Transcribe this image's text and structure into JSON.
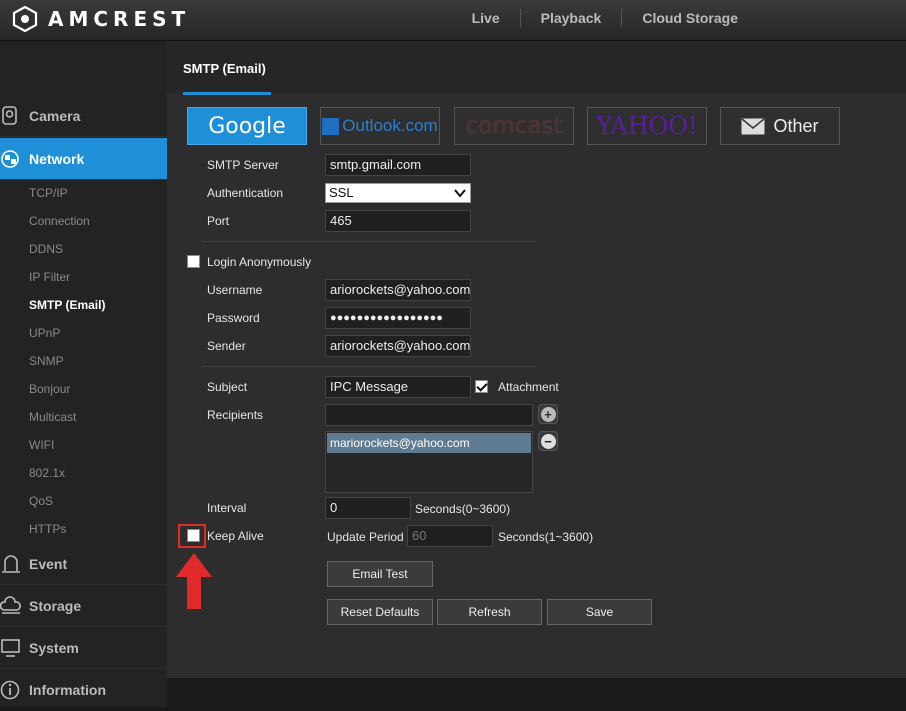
{
  "header": {
    "brand": "AMCREST",
    "nav": [
      "Live",
      "Playback",
      "Cloud Storage"
    ]
  },
  "sidebar": {
    "sections": [
      {
        "label": "Camera",
        "icon": "camera-icon"
      },
      {
        "label": "Network",
        "icon": "network-icon",
        "active": true
      },
      {
        "label": "Event",
        "icon": "event-icon"
      },
      {
        "label": "Storage",
        "icon": "storage-icon"
      },
      {
        "label": "System",
        "icon": "system-icon"
      },
      {
        "label": "Information",
        "icon": "information-icon"
      }
    ],
    "network_items": [
      "TCP/IP",
      "Connection",
      "DDNS",
      "IP Filter",
      "SMTP (Email)",
      "UPnP",
      "SNMP",
      "Bonjour",
      "Multicast",
      "WIFI",
      "802.1x",
      "QoS",
      "HTTPs"
    ],
    "current_item": "SMTP (Email)"
  },
  "tab": {
    "label": "SMTP (Email)"
  },
  "providers": {
    "google": "Google",
    "outlook": "Outlook.com",
    "comcast": "comcast",
    "yahoo": "YAHOO!",
    "other": "Other"
  },
  "form": {
    "smtp_server_label": "SMTP Server",
    "smtp_server_value": "smtp.gmail.com",
    "authentication_label": "Authentication",
    "authentication_value": "SSL",
    "port_label": "Port",
    "port_value": "465",
    "login_anonymously_label": "Login Anonymously",
    "username_label": "Username",
    "username_value": "ariorockets@yahoo.com",
    "password_label": "Password",
    "password_value": "●●●●●●●●●●●●●●●●●",
    "sender_label": "Sender",
    "sender_value": "ariorockets@yahoo.com",
    "subject_label": "Subject",
    "subject_value": "IPC Message",
    "attachment_label": "Attachment",
    "recipients_label": "Recipients",
    "recipient_input_value": "",
    "recipients": [
      "mariorockets@yahoo.com"
    ],
    "interval_label": "Interval",
    "interval_value": "0",
    "interval_unit": "Seconds(0~3600)",
    "keep_alive_label": "Keep Alive",
    "update_period_label": "Update Period",
    "update_period_value": "60",
    "update_period_unit": "Seconds(1~3600)"
  },
  "buttons": {
    "email_test": "Email Test",
    "reset_defaults": "Reset Defaults",
    "refresh": "Refresh",
    "save": "Save"
  },
  "colors": {
    "accent": "#1f8fd8",
    "highlight": "#e12b2b"
  }
}
